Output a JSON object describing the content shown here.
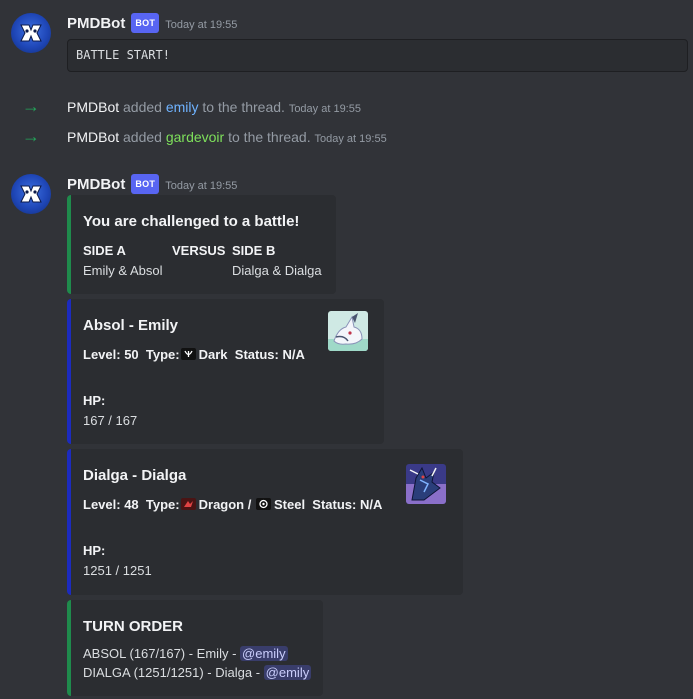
{
  "messages": [
    {
      "author": "PMDBot",
      "badge": "BOT",
      "time": "Today at 19:55",
      "code": "BATTLE START!"
    },
    {
      "author": "PMDBot",
      "badge": "BOT",
      "time": "Today at 19:55"
    }
  ],
  "system": [
    {
      "actor": "PMDBot",
      "verb": "added",
      "user": "emily",
      "user_color": "#6fb3ff",
      "rest": "to the thread.",
      "time": "Today at 19:55"
    },
    {
      "actor": "PMDBot",
      "verb": "added",
      "user": "gardevoir",
      "user_color": "#7ee05b",
      "rest": "to the thread.",
      "time": "Today at 19:55"
    }
  ],
  "embeds": {
    "challenge": {
      "title": "You are challenged to a battle!",
      "side_a_label": "SIDE A",
      "versus_label": "VERSUS",
      "side_b_label": "SIDE B",
      "side_a_value": "Emily & Absol",
      "side_b_value": "Dialga & Dialga",
      "color": "#1f8b4c"
    },
    "absol": {
      "title": "Absol - Emily",
      "level_label": "Level:",
      "level": "50",
      "type_label": "Type:",
      "type1": "Dark",
      "status_label": "Status:",
      "status": "N/A",
      "hp_label": "HP:",
      "hp": "167 / 167",
      "color": "#1c2bbf"
    },
    "dialga": {
      "title": "Dialga - Dialga",
      "level_label": "Level:",
      "level": "48",
      "type_label": "Type:",
      "type1": "Dragon /",
      "type2": "Steel",
      "status_label": "Status:",
      "status": "N/A",
      "hp_label": "HP:",
      "hp": "1251 / 1251",
      "color": "#1c2bbf"
    },
    "turn_order": {
      "title": "TURN ORDER",
      "lines": [
        {
          "text": "ABSOL (167/167) - Emily -",
          "mention": "@emily"
        },
        {
          "text": "DIALGA (1251/1251) - Dialga -",
          "mention": "@emily"
        }
      ],
      "color": "#1f8b4c"
    }
  },
  "icons": {
    "avatar": "pmdbot-avatar-icon",
    "system_arrow": "arrow-right-icon",
    "absol_thumb": "absol-sprite",
    "dialga_thumb": "dialga-sprite",
    "dark_type": "dark-type-icon",
    "dragon_type": "dragon-type-icon",
    "steel_type": "steel-type-icon"
  }
}
